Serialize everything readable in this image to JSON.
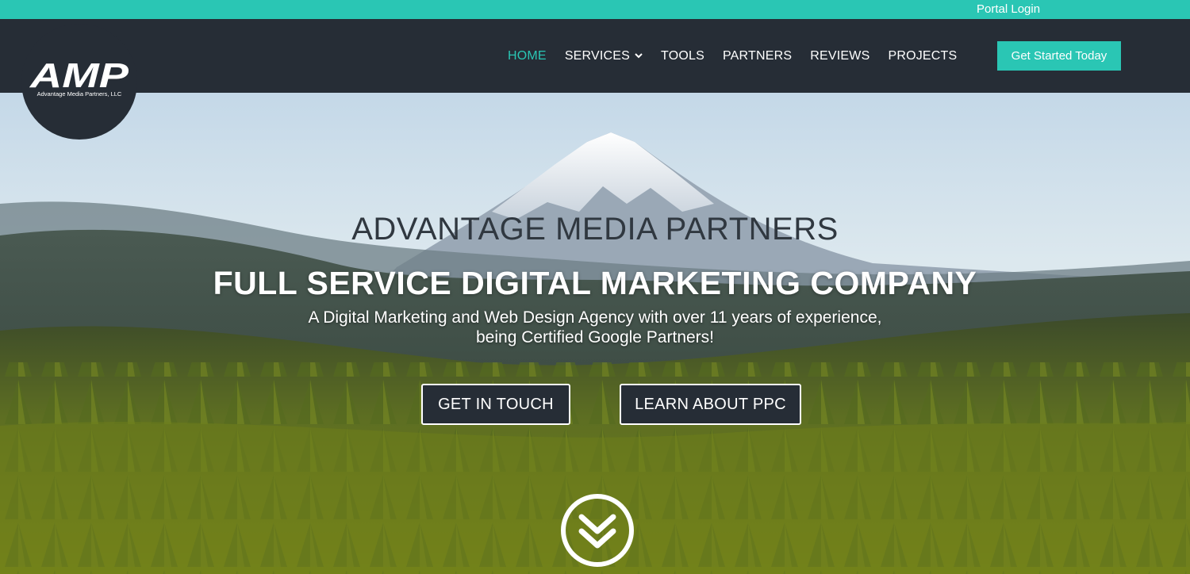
{
  "topbar": {
    "portal_login": "Portal Login"
  },
  "brand": {
    "logo_text": "AMP",
    "logo_subtitle": "Advantage Media Partners, LLC"
  },
  "nav": {
    "items": [
      {
        "label": "HOME",
        "active": true
      },
      {
        "label": "SERVICES",
        "active": false,
        "has_dropdown": true
      },
      {
        "label": "TOOLS",
        "active": false
      },
      {
        "label": "PARTNERS",
        "active": false
      },
      {
        "label": "REVIEWS",
        "active": false
      },
      {
        "label": "PROJECTS",
        "active": false
      }
    ],
    "cta_label": "Get Started Today"
  },
  "hero": {
    "title": "ADVANTAGE MEDIA PARTNERS",
    "subtitle": "FULL SERVICE DIGITAL MARKETING COMPANY",
    "description_line1": "A Digital Marketing and Web Design Agency with over 11 years of experience,",
    "description_line2": "being Certified Google Partners!",
    "buttons": {
      "get_in_touch": "GET IN TOUCH",
      "learn_ppc": "LEARN ABOUT PPC"
    },
    "scroll_icon": "double-chevron-down-icon"
  },
  "colors": {
    "accent": "#2ac6b4",
    "header_bg": "#262d36",
    "text_light": "#ffffff",
    "title_dark": "#303840"
  }
}
